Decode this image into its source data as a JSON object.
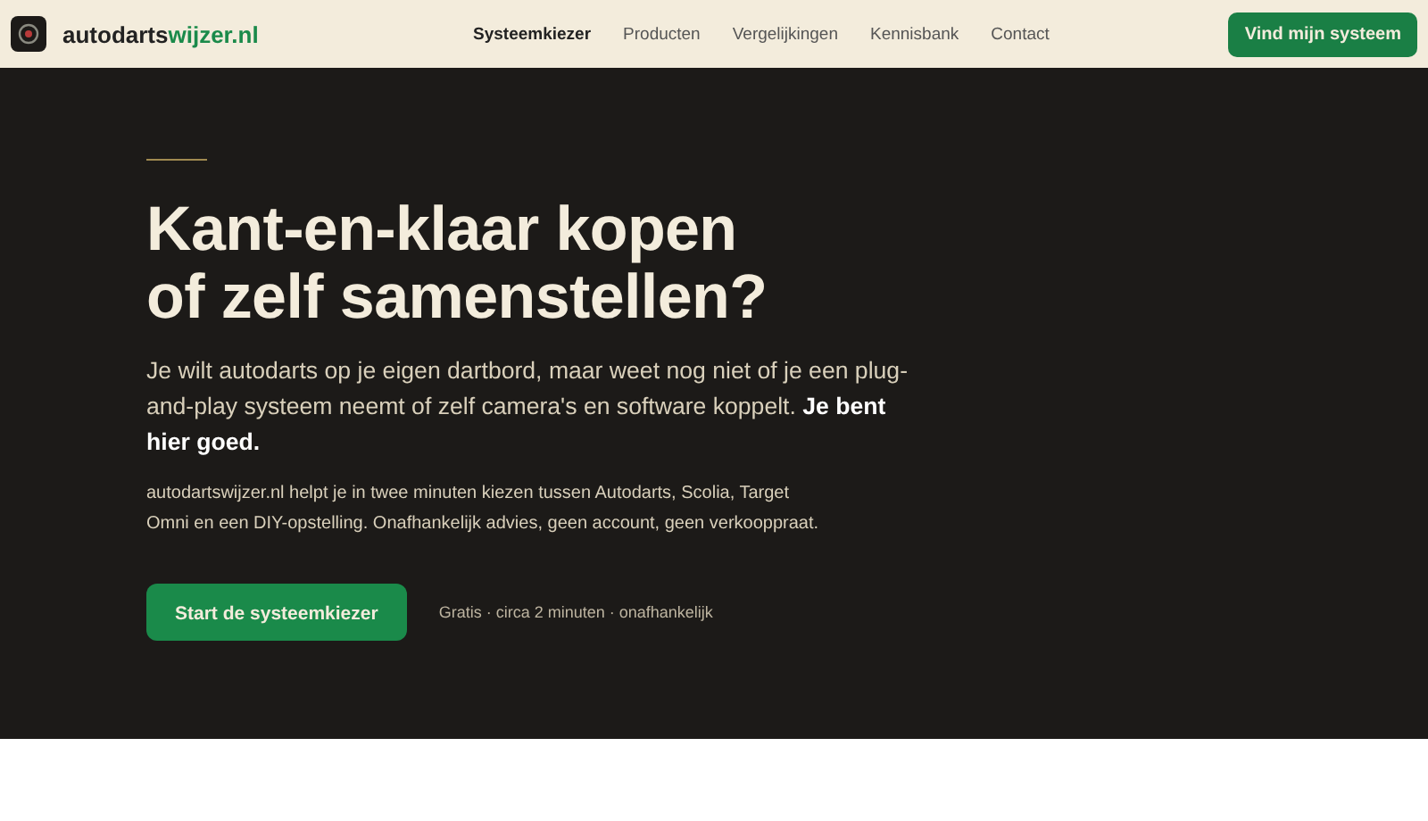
{
  "header": {
    "logo": {
      "name": "autodarts",
      "accent": "wijzer.nl"
    },
    "nav": [
      {
        "label": "Systeemkiezer",
        "selected": true
      },
      {
        "label": "Producten",
        "selected": false
      },
      {
        "label": "Vergelijkingen",
        "selected": false
      },
      {
        "label": "Kennisbank",
        "selected": false
      },
      {
        "label": "Contact",
        "selected": false
      }
    ],
    "cta": "Vind mijn systeem"
  },
  "hero": {
    "title_lines": [
      "Kant-en-klaar kopen",
      "of zelf samenstellen?"
    ],
    "lead": "Je wilt autodarts op je eigen dartbord, maar weet nog niet of je een plug-and-play systeem neemt of zelf camera's en software koppelt. **Je bent hier goed.**",
    "body": "autodartswijzer.nl helpt je in twee minuten kiezen tussen Autodarts, Scolia, Target Omni en een DIY-opstelling. Onafhankelijk advies, geen account, geen verkooppraat.",
    "button": "Start de systeemkiezer",
    "note": "Gratis · circa 2 minuten · onafhankelijk"
  }
}
